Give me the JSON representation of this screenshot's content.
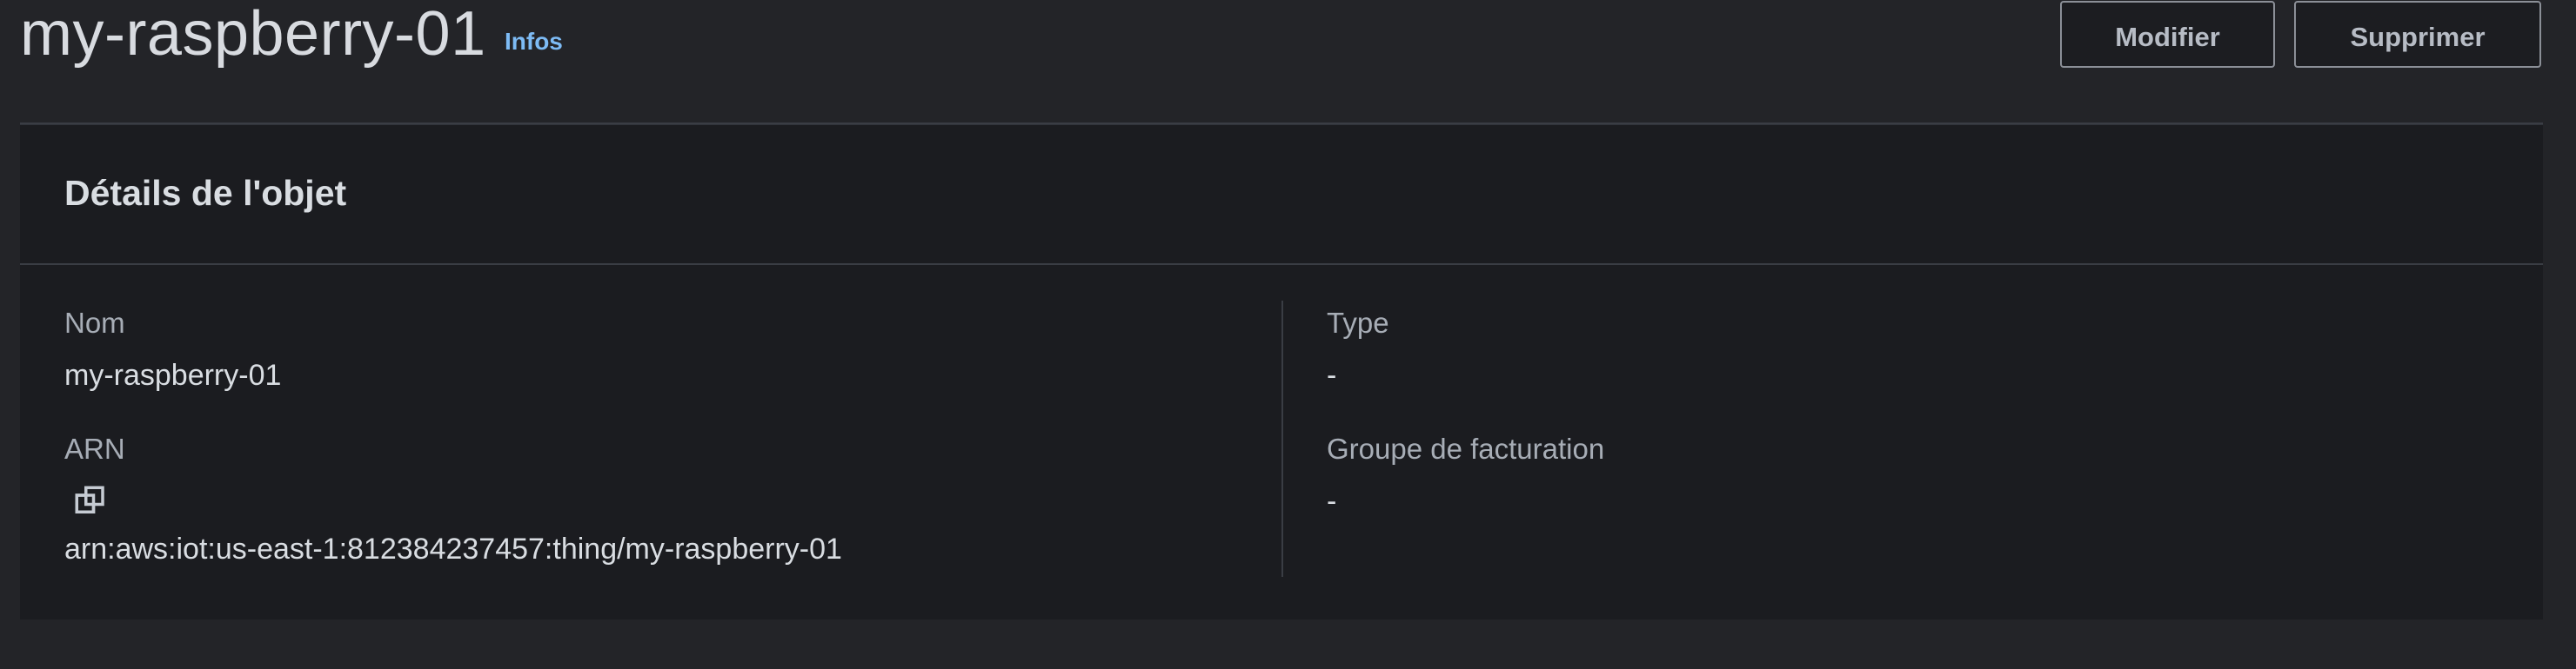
{
  "header": {
    "title": "my-raspberry-01",
    "info_link": "Infos",
    "actions": {
      "edit_label": "Modifier",
      "delete_label": "Supprimer"
    }
  },
  "details": {
    "title": "Détails de l'objet",
    "name": {
      "label": "Nom",
      "value": "my-raspberry-01"
    },
    "arn": {
      "label": "ARN",
      "value": "arn:aws:iot:us-east-1:812384237457:thing/my-raspberry-01",
      "copy_icon": "copy-icon"
    },
    "type": {
      "label": "Type",
      "value": "-"
    },
    "billing_group": {
      "label": "Groupe de facturation",
      "value": "-"
    }
  },
  "colors": {
    "background": "#232428",
    "panel": "#1b1c20",
    "text": "#d9dde2",
    "muted_text": "#a7adb6",
    "link": "#7dbbf5",
    "border": "#3a3d44"
  }
}
